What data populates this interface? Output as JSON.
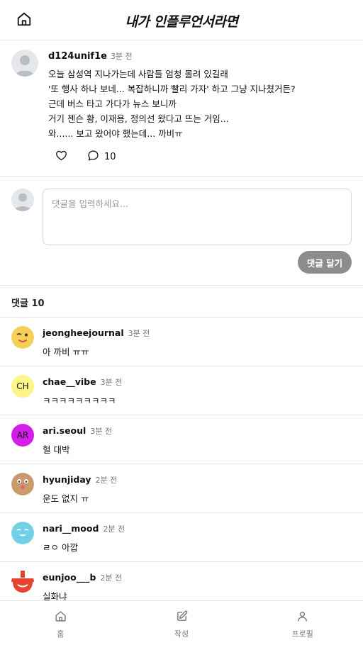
{
  "header": {
    "title": "내가 인플루언서라면",
    "home_icon": "home-icon"
  },
  "post": {
    "author": "d124unif1e",
    "time": "3분 전",
    "lines": [
      "오늘 삼성역 지나가는데 사람들 엄청 몰려 있길래",
      "'또 행사 하나 보네... 복잡하니까 빨리 가자' 하고 그냥 지나쳤거든?",
      "근데 버스 타고 가다가 뉴스 보니까",
      "거기 젠슨 황, 이재용, 정의선 왔다고 뜨는 거임...",
      "와...... 보고 왔어야 했는데... 까비ㅠ"
    ],
    "comment_count": "10"
  },
  "composer": {
    "placeholder": "댓글을 입력하세요...",
    "value": "",
    "submit_label": "댓글 달기"
  },
  "comments_header": "댓글 10",
  "comments": [
    {
      "author": "jeongheejournal",
      "time": "3분 전",
      "text": "아 까비 ㅠㅠ",
      "avatar": "emoji-wink"
    },
    {
      "author": "chae__vibe",
      "time": "3분 전",
      "text": "ㅋㅋㅋㅋㅋㅋㅋㅋㅋ",
      "avatar_initials": "CH",
      "avatar_color": "#fdf587"
    },
    {
      "author": "ari.seoul",
      "time": "3분 전",
      "text": "헐 대박",
      "avatar_initials": "AR",
      "avatar_color": "#d21ee8"
    },
    {
      "author": "hyunjiday",
      "time": "2분 전",
      "text": "운도 없지 ㅠ",
      "avatar": "emoji-face-tan"
    },
    {
      "author": "nari__mood",
      "time": "2분 전",
      "text": "ㄹㅇ 아깝",
      "avatar": "emoji-face-cyan"
    },
    {
      "author": "eunjoo___b",
      "time": "2분 전",
      "text": "실화냐",
      "avatar": "emoji-face-red"
    }
  ],
  "nav": [
    {
      "label": "홈",
      "icon": "home-icon"
    },
    {
      "label": "작성",
      "icon": "edit-icon"
    },
    {
      "label": "프로필",
      "icon": "user-icon"
    }
  ],
  "colors": {
    "divider": "#e6e6e6",
    "button_gray": "#8c8c8c",
    "muted_text": "#777777"
  }
}
